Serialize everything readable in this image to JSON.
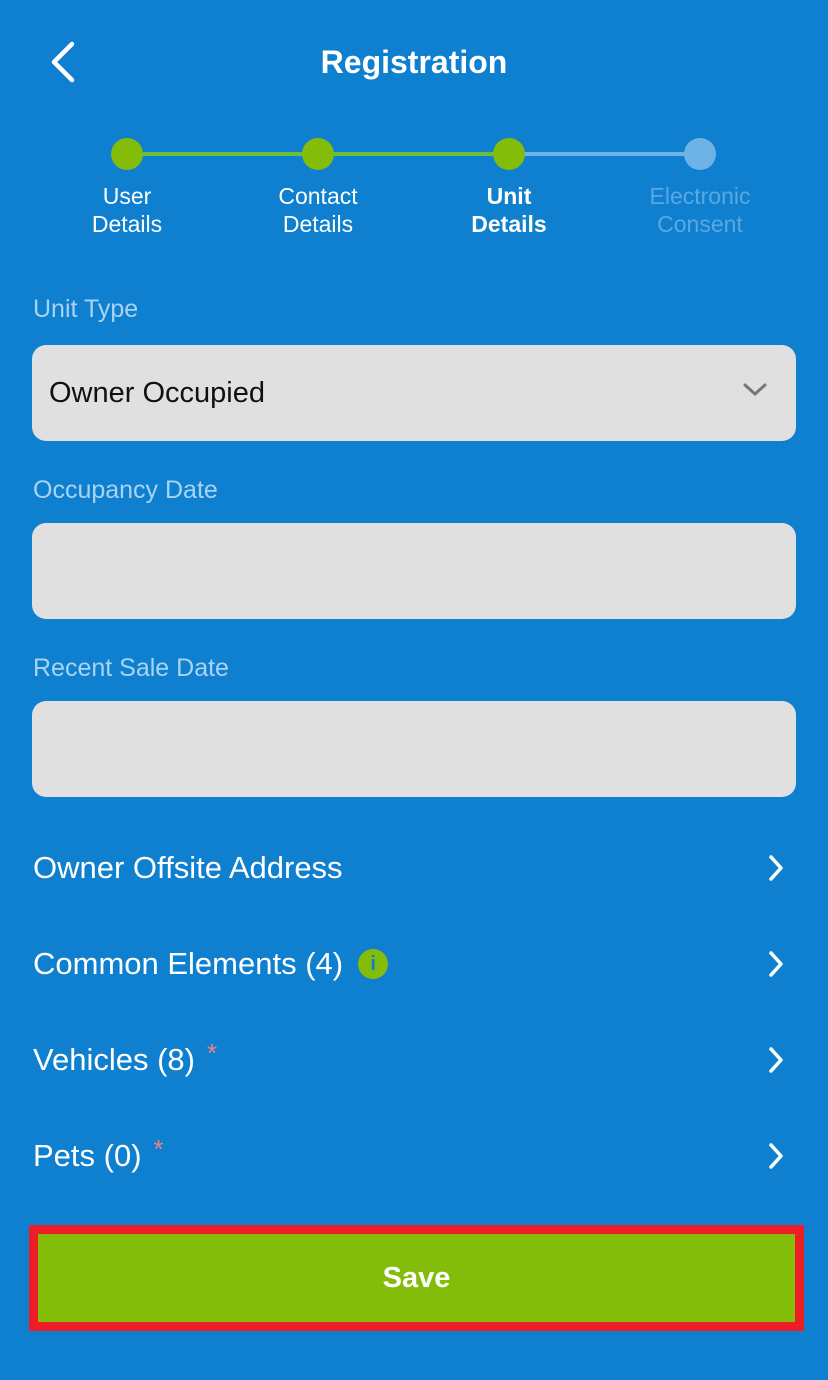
{
  "header": {
    "title": "Registration",
    "back_icon": "chevron-left-icon"
  },
  "stepper": {
    "current_step": 3,
    "colors": {
      "complete": "#84bc0a",
      "pending": "#6db3e6"
    },
    "steps": [
      {
        "line1": "User",
        "line2": "Details",
        "state": "complete"
      },
      {
        "line1": "Contact",
        "line2": "Details",
        "state": "complete"
      },
      {
        "line1": "Unit",
        "line2": "Details",
        "state": "current"
      },
      {
        "line1": "Electronic",
        "line2": "Consent",
        "state": "pending"
      }
    ]
  },
  "form": {
    "unit_type": {
      "label": "Unit Type",
      "value": "Owner Occupied"
    },
    "occupancy_date": {
      "label": "Occupancy Date",
      "value": ""
    },
    "recent_sale_date": {
      "label": "Recent Sale Date",
      "value": ""
    }
  },
  "links": [
    {
      "label": "Owner Offsite Address"
    },
    {
      "label": "Common Elements (4)",
      "info": "i"
    },
    {
      "label": "Vehicles (8)",
      "required": "*"
    },
    {
      "label": "Pets (0)",
      "required": "*"
    }
  ],
  "save": {
    "label": "Save",
    "color": "#84bc0a",
    "highlight_color": "#ee1c25"
  }
}
